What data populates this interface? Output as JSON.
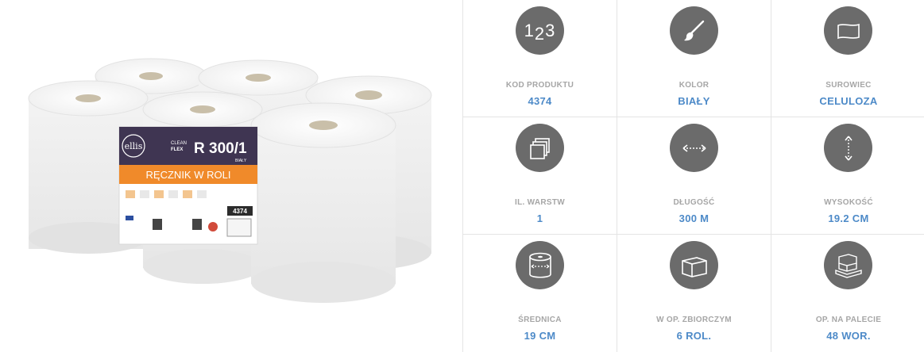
{
  "product_image": {
    "brand": "ellis",
    "line_top": "CLEAN",
    "line_bottom": "FLEX",
    "model": "R 300/1",
    "color_small": "BIAŁY",
    "product_name": "RĘCZNIK W ROLI",
    "code_badge": "4374"
  },
  "specs": [
    {
      "label": "KOD PRODUKTU",
      "value": "4374",
      "icon": "numbers-123-icon",
      "icon_text": "123"
    },
    {
      "label": "KOLOR",
      "value": "BIAŁY",
      "icon": "paintbrush-icon"
    },
    {
      "label": "SUROWIEC",
      "value": "CELULOZA",
      "icon": "paper-sheet-icon"
    },
    {
      "label": "IL. WARSTW",
      "value": "1",
      "icon": "layers-stack-icon"
    },
    {
      "label": "DŁUGOŚĆ",
      "value": "300 M",
      "icon": "horizontal-arrow-icon"
    },
    {
      "label": "WYSOKOŚĆ",
      "value": "19.2 CM",
      "icon": "vertical-arrow-icon"
    },
    {
      "label": "ŚREDNICA",
      "value": "19 CM",
      "icon": "roll-diameter-icon"
    },
    {
      "label": "W OP. ZBIORCZYM",
      "value": "6 ROL.",
      "icon": "box-icon"
    },
    {
      "label": "OP. NA PALECIE",
      "value": "48 WOR.",
      "icon": "pallet-icon"
    }
  ]
}
